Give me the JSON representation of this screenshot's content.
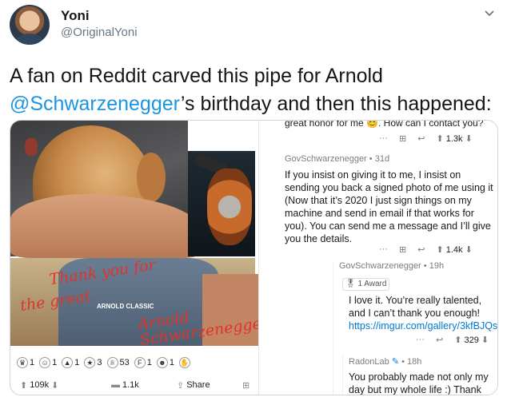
{
  "tweet": {
    "name": "Yoni",
    "handle": "@OriginalYoni",
    "text_before": "A fan on Reddit carved this pipe for Arnold ",
    "mention": "@Schwarzenegger",
    "text_after": "’s birthday and then this happened:"
  },
  "photo": {
    "signature_lines": [
      "Thank you for",
      "the great",
      "Arnold Schwarzenegger"
    ],
    "shirt_text": "ARNOLD CLASSIC"
  },
  "reddit_post": {
    "awards": [
      {
        "icon": "crown-award-icon",
        "count": "1"
      },
      {
        "icon": "wholesome-award-icon",
        "count": "1"
      },
      {
        "icon": "helpful-award-icon",
        "count": "1"
      },
      {
        "icon": "gold-award-icon",
        "count": "3"
      },
      {
        "icon": "trophy-award-icon",
        "count": "53"
      },
      {
        "icon": "f-award-icon",
        "count": "1"
      },
      {
        "icon": "laugh-award-icon",
        "count": "1"
      },
      {
        "icon": "clap-award-icon",
        "count": ""
      }
    ],
    "upvotes": "109k",
    "comments": "1.1k",
    "share_label": "Share"
  },
  "comments": [
    {
      "cut_text": "great honor for me 😊. How can I contact you?",
      "more": "···",
      "score": "1.3k"
    },
    {
      "author": "GovSchwarzenegger",
      "age": "31d",
      "body": "If you insist on giving it to me, I insist on sending you back a signed photo of me using it (Now that it’s 2020 I just sign things on my machine and send in email if that works for you). You can send me a message and I’ll give you the details.",
      "more": "···",
      "score": "1.4k"
    },
    {
      "author": "GovSchwarzenegger",
      "age": "19h",
      "award": "1 Award",
      "body_text": "I love it. You’re really talented, and I can’t thank you enough! ",
      "link": "https://imgur.com/gallery/3kfBJQs",
      "more": "···",
      "score": "329"
    },
    {
      "author": "RadonLab",
      "age": "18h",
      "body": "You probably made not only my day but my whole life :) Thank"
    }
  ],
  "colors": {
    "mention": "#1b95e0",
    "signature": "#e0342b",
    "reddit_link": "#0079d3"
  }
}
